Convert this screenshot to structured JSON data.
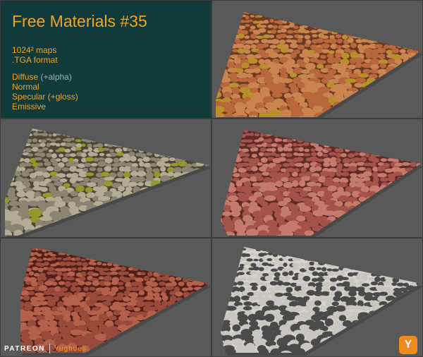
{
  "info": {
    "title": "Free Materials #35",
    "maps": "1024² maps",
    "format": ".TGA format",
    "diffuse": "Diffuse",
    "diffuse_extra": "(+alpha)",
    "normal": "Normal",
    "specular": "Specular (+gloss)",
    "emissive": "Emissive"
  },
  "footer": {
    "brand": "PATREON",
    "author": "Yughues",
    "logo_letter": "Y"
  },
  "colors": {
    "accent": "#f3a324",
    "panel_bg": "#113a3a",
    "viewport_bg": "#595959"
  },
  "materials": [
    {
      "name": "orange-stone-floor",
      "base": "#b8683c",
      "stone": "#c9844f",
      "joint": "#6b3a22",
      "moss": "#b8902a"
    },
    {
      "name": "grey-mossy-cobble",
      "base": "#8a8470",
      "stone": "#b3ac95",
      "joint": "#4b4636",
      "moss": "#8f9a2a"
    },
    {
      "name": "red-stone-floor",
      "base": "#a5524a",
      "stone": "#c47a6c",
      "joint": "#5e2b26",
      "moss": ""
    },
    {
      "name": "red-slab-paving",
      "base": "#9a4a3a",
      "stone": "#b5604a",
      "joint": "#4e2019",
      "moss": ""
    },
    {
      "name": "dark-cobblestone",
      "base": "#c9c6c0",
      "stone": "#4a4a4a",
      "joint": "#d6d3cc",
      "moss": ""
    }
  ]
}
